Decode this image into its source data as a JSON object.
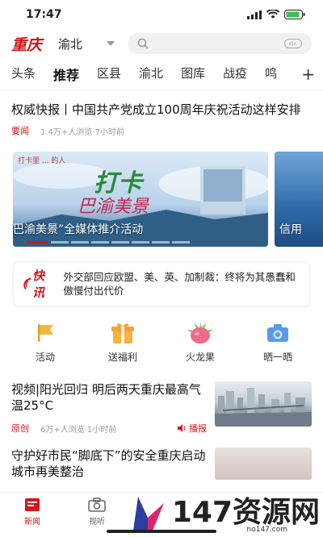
{
  "status_bar": {
    "time": "17:47"
  },
  "header": {
    "logo": "重庆",
    "city": "渝北"
  },
  "tabs": [
    "头条",
    "推荐",
    "区县",
    "渝北",
    "图库",
    "战疫",
    "鸣"
  ],
  "tabs_active": "推荐",
  "tabs_plus": "+",
  "news1": {
    "title": "权威快报丨中国共产党成立100周年庆祝活动这样安排",
    "tag": "要闻",
    "views": "1.4万+人浏览",
    "time": "·7小时前"
  },
  "banner": {
    "caption_main": "寻巴渝美景”全媒体推介活动",
    "caption_side": "信用",
    "art_line1": "打卡",
    "art_line2": "巴渝美景"
  },
  "flash": {
    "logo": "快讯",
    "text": "外交部回应欧盟、美、英、加制裁：终将为其愚蠢和傲慢付出代价"
  },
  "quick_links": [
    {
      "label": "活动",
      "icon": "flag-icon",
      "color": "#f1b93b"
    },
    {
      "label": "送福利",
      "icon": "gift-icon",
      "color": "#f3a23a"
    },
    {
      "label": "火龙果",
      "icon": "dragonfruit-icon",
      "color": "#ec6b8c"
    },
    {
      "label": "晒一晒",
      "icon": "camera-icon",
      "color": "#5a9be8"
    }
  ],
  "news2": {
    "title": "视频|阳光回归 明后两天重庆最高气温25°C",
    "tag": "原创",
    "views": "6万+人浏览",
    "time": "·1小时前",
    "action": "播报"
  },
  "news3": {
    "title": "守护好市民“脚底下”的安全重庆启动城市再美整治"
  },
  "tabbar": {
    "items": [
      "新闻",
      "视听"
    ]
  },
  "watermark": {
    "big": "147资源网",
    "small": "no147.com"
  },
  "colors": {
    "brand_red": "#d0171b"
  }
}
